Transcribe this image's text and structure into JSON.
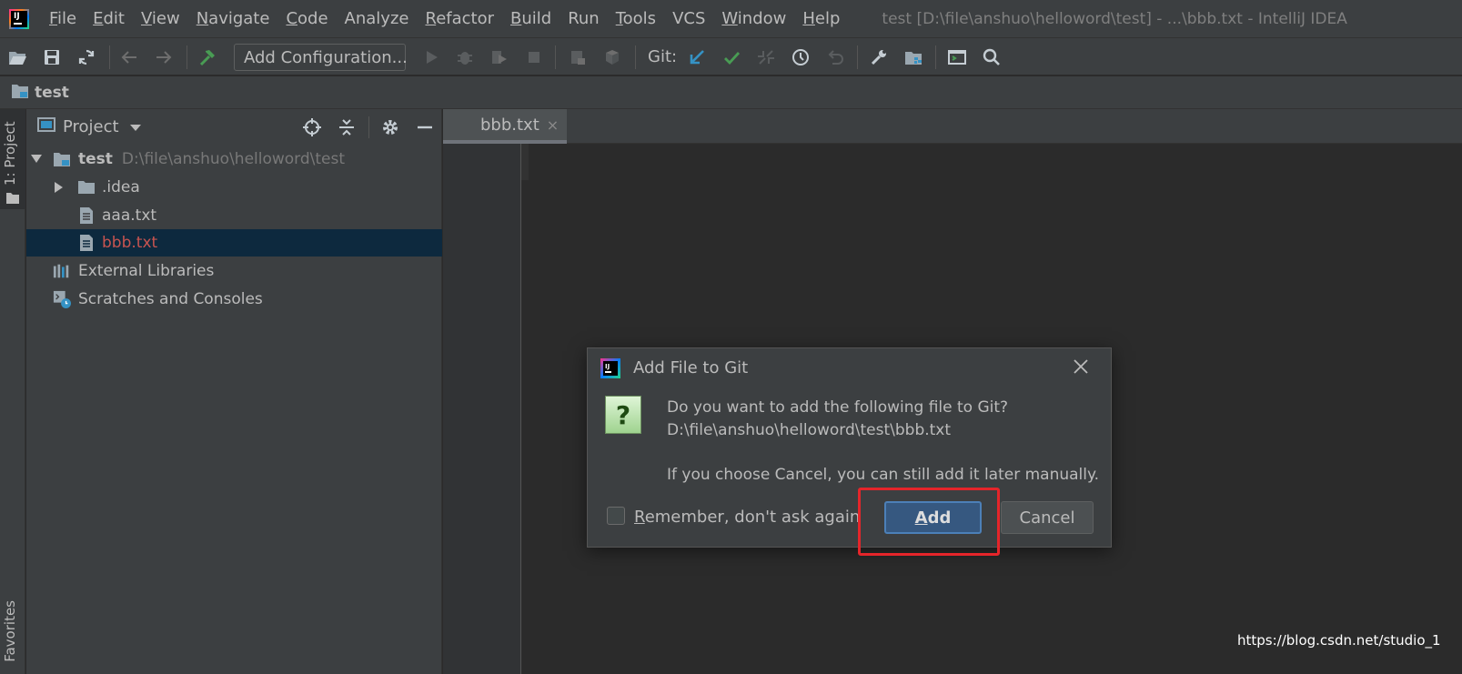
{
  "menubar": {
    "items": [
      {
        "m": "F",
        "r": "ile"
      },
      {
        "m": "E",
        "r": "dit"
      },
      {
        "m": "V",
        "r": "iew"
      },
      {
        "m": "N",
        "r": "avigate"
      },
      {
        "m": "C",
        "r": "ode"
      },
      {
        "m": "",
        "r": "Analyze"
      },
      {
        "m": "R",
        "r": "efactor"
      },
      {
        "m": "B",
        "r": "uild"
      },
      {
        "m": "",
        "r": "Run"
      },
      {
        "m": "T",
        "r": "ools"
      },
      {
        "m": "",
        "r": "VCS"
      },
      {
        "m": "W",
        "r": "indow"
      },
      {
        "m": "H",
        "r": "elp"
      }
    ],
    "window_title": "test [D:\\file\\anshuo\\helloword\\test] - ...\\bbb.txt - IntelliJ IDEA"
  },
  "toolbar": {
    "add_configuration": "Add Configuration...",
    "git_label": "Git:"
  },
  "navbar": {
    "project_name": "test"
  },
  "left_stripe": {
    "project_tab": "1: Project",
    "favorites_tab": "Favorites"
  },
  "project_panel": {
    "title": "Project",
    "tree": {
      "root": {
        "name": "test",
        "path": "D:\\file\\anshuo\\helloword\\test"
      },
      "idea_folder": ".idea",
      "aaa_file": "aaa.txt",
      "bbb_file": "bbb.txt",
      "external_libraries": "External Libraries",
      "scratches": "Scratches and Consoles"
    }
  },
  "editor": {
    "tab_label": "bbb.txt",
    "tab_close": "×"
  },
  "dialog": {
    "title": "Add File to Git",
    "question_glyph": "?",
    "message_line1": "Do you want to add the following file to Git?",
    "message_line2": "D:\\file\\anshuo\\helloword\\test\\bbb.txt",
    "message_line3": "If you choose Cancel, you can still add it later manually.",
    "remember_mnemonic": "R",
    "remember_rest": "emember, don't ask again",
    "add_mnemonic": "A",
    "add_rest": "dd",
    "cancel_label": "Cancel"
  },
  "watermark": "https://blog.csdn.net/studio_1",
  "colors": {
    "background": "#2b2b2b",
    "panel": "#3c3f41",
    "selection": "#0d293e",
    "modified_file": "#c75450",
    "primary_button": "#365880",
    "highlight_box": "#e5252a"
  }
}
